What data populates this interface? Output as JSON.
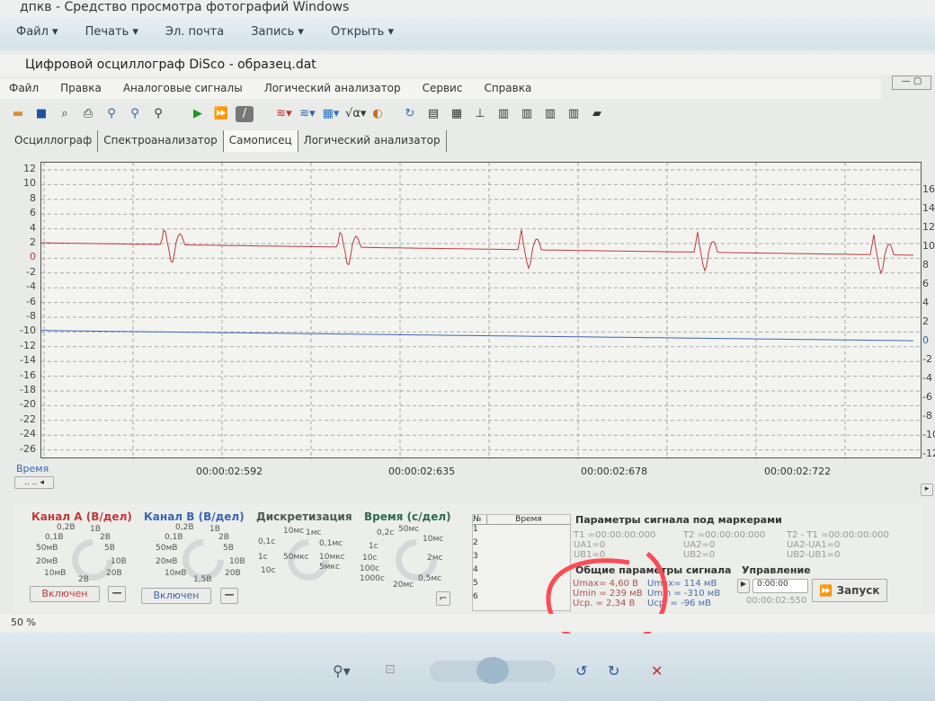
{
  "viewer": {
    "title": "дпкв - Средство просмотра фотографий Windows",
    "menu": [
      "Файл ▾",
      "Печать ▾",
      "Эл. почта",
      "Запись ▾",
      "Открыть ▾"
    ]
  },
  "app": {
    "title": "Цифровой осциллограф DiSco - образец.dat",
    "menu": [
      "Файл",
      "Правка",
      "Аналоговые сигналы",
      "Логический анализатор",
      "Сервис",
      "Справка"
    ],
    "tabs": [
      "Осциллограф",
      "Спектроанализатор",
      "Самописец",
      "Логический анализатор"
    ],
    "active_tab": 2
  },
  "chart_data": {
    "type": "line",
    "left_axis": {
      "ticks": [
        12,
        10,
        8,
        6,
        4,
        2,
        0,
        -2,
        -4,
        -6,
        -8,
        -10,
        -12,
        -14,
        -16,
        -18,
        -20,
        -22,
        -24,
        -26
      ],
      "range": [
        12.5,
        -27
      ]
    },
    "right_axis": {
      "ticks": [
        16,
        14,
        12,
        10,
        8,
        6,
        4,
        2,
        0,
        -2,
        -4,
        -6,
        -8,
        -10,
        -12
      ]
    },
    "xlabel": "Время",
    "x_ticks": [
      "00:00:02:592",
      "00:00:02:635",
      "00:00:02:678",
      "00:00:02:722"
    ],
    "series": [
      {
        "name": "Канал A",
        "color": "#c0393b",
        "baseline_start": 2.1,
        "baseline_end": 0.4,
        "spike_positions": [
          0.14,
          0.34,
          0.545,
          0.745,
          0.945
        ]
      },
      {
        "name": "Канал B",
        "color": "#3b64b4",
        "baseline_start": -9.8,
        "baseline_end": -11.2
      }
    ]
  },
  "controls": {
    "chA": {
      "title": "Канал A (В/дел)",
      "scale": [
        "0,2В",
        "1В",
        "0,1В",
        "2В",
        "50мВ",
        "5В",
        "20мВ",
        "10В",
        "10мВ",
        "20В",
        "2В"
      ],
      "button": "Включен"
    },
    "chB": {
      "title": "Канал B (В/дел)",
      "scale": [
        "0,2В",
        "1В",
        "0,1В",
        "2В",
        "50мВ",
        "5В",
        "20мВ",
        "10В",
        "10мВ",
        "20В",
        "1,5В"
      ],
      "button": "Включен"
    },
    "disc": {
      "title": "Дискретизация",
      "scale": [
        "10мс",
        "1мс",
        "0,1с",
        "0,1мс",
        "1с",
        "50мкс",
        "10мкс",
        "10с",
        "5мкс"
      ]
    },
    "time": {
      "title": "Время (с/дел)",
      "scale": [
        "0,2с",
        "50мс",
        "10мс",
        "1с",
        "10с",
        "2мс",
        "100с",
        "1000с",
        "0,5мс",
        "20мс"
      ]
    }
  },
  "markers_table": {
    "headers": [
      "№",
      "Время"
    ],
    "rows": [
      "1",
      "2",
      "3",
      "4",
      "5",
      "6"
    ]
  },
  "marker_params": {
    "title": "Параметры сигнала под маркерами",
    "t1": "T1 =00:00:00:000",
    "t2": "T2 =00:00:00:000",
    "dt": "T2 - T1 =00:00:00:000",
    "ua1": "UA1=0",
    "ub1": "UB1=0",
    "ua2": "UA2=0",
    "ub2": "UB2=0",
    "dua": "UA2-UA1=0",
    "dub": "UB2-UB1=0"
  },
  "general_params": {
    "title": "Общие параметры сигнала",
    "a": [
      "Umax= 4,60 В",
      "Umin = 239 мВ",
      "Uср. = 2,34 В"
    ],
    "b": [
      "Umax= 114 мВ",
      "Umin = -310 мВ",
      "Uср. = -96 мВ"
    ]
  },
  "control": {
    "title": "Управление",
    "time": "0:00:00",
    "elapsed": "00:00:02:550",
    "start": "Запуск"
  },
  "status": "50 %",
  "colors": {
    "chA": "#c0393b",
    "chB": "#3b64b4",
    "annotation": "#ff4a55"
  }
}
